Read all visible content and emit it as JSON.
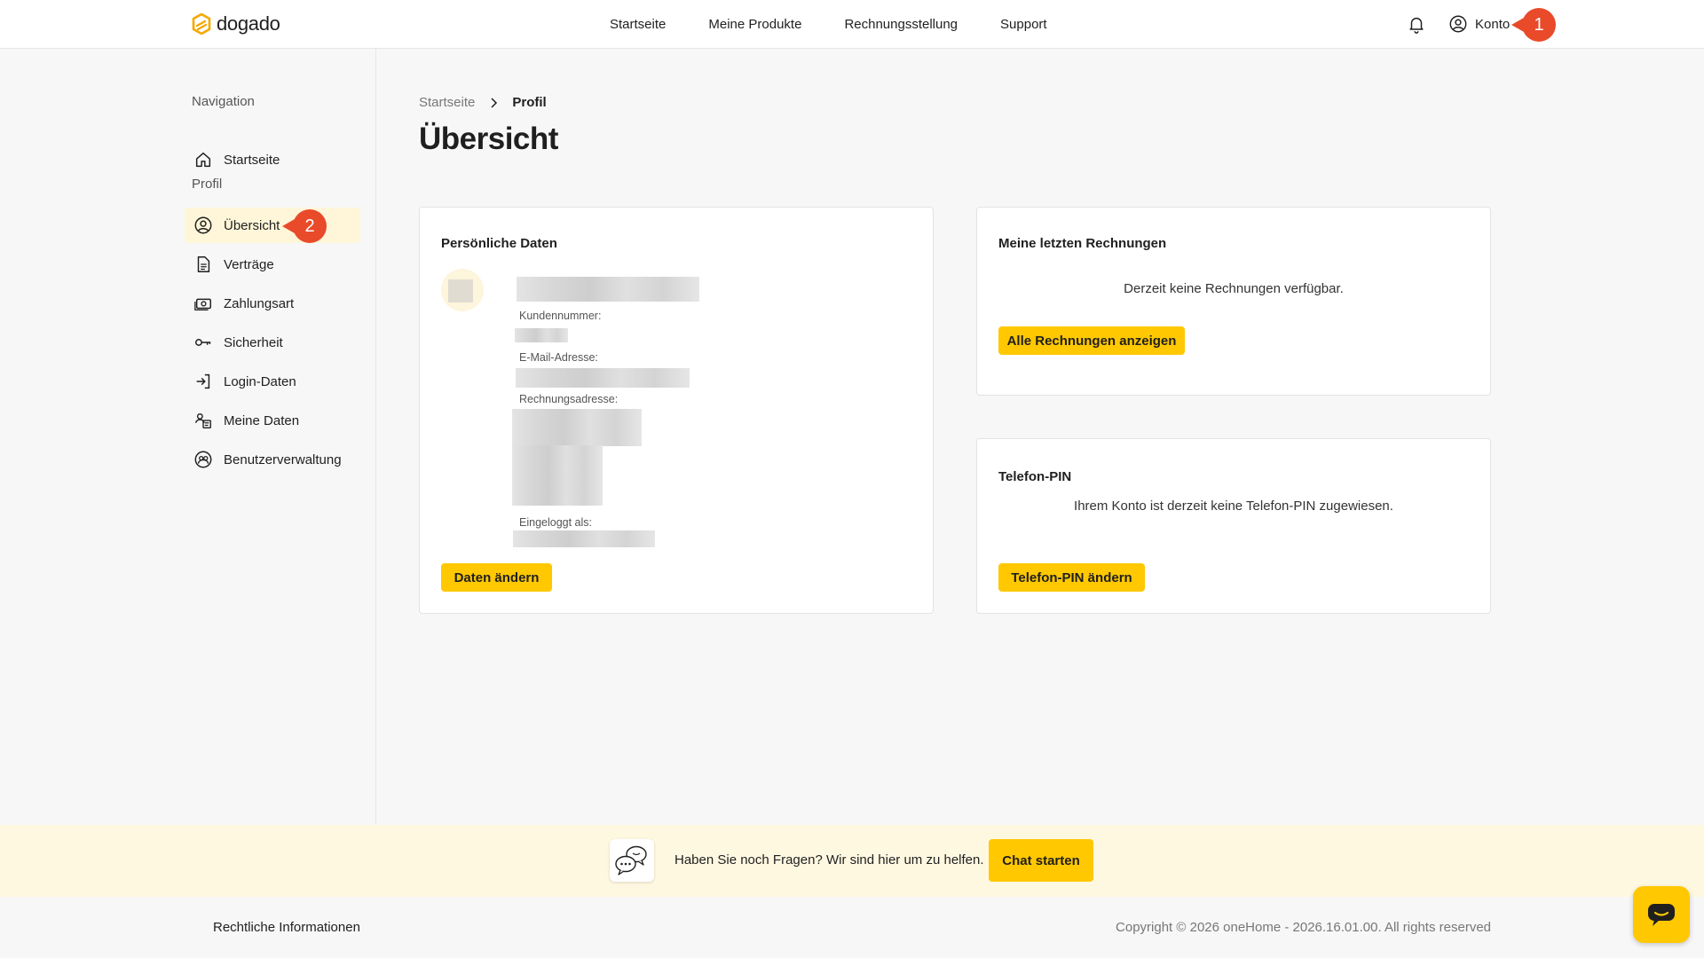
{
  "brand": {
    "name": "dogado",
    "accent": "#ffc800",
    "logo_color": "#f5a800"
  },
  "topnav": {
    "items": [
      {
        "label": "Startseite"
      },
      {
        "label": "Meine Produkte"
      },
      {
        "label": "Rechnungsstellung"
      },
      {
        "label": "Support"
      }
    ],
    "account_label": "Konto",
    "account_marker": "1"
  },
  "sidebar": {
    "section_navigation": "Navigation",
    "section_profile": "Profil",
    "items": [
      {
        "label": "Startseite",
        "icon": "home-icon"
      },
      {
        "label": "Übersicht",
        "icon": "user-circle-icon",
        "active": true
      },
      {
        "label": "Verträge",
        "icon": "document-icon"
      },
      {
        "label": "Zahlungsart",
        "icon": "money-icon"
      },
      {
        "label": "Sicherheit",
        "icon": "key-icon"
      },
      {
        "label": "Login-Daten",
        "icon": "login-icon"
      },
      {
        "label": "Meine Daten",
        "icon": "data-settings-icon"
      },
      {
        "label": "Benutzerverwaltung",
        "icon": "users-icon"
      }
    ],
    "active_marker": "2"
  },
  "breadcrumb": {
    "parent": "Startseite",
    "current": "Profil"
  },
  "page_title": "Übersicht",
  "personal_card": {
    "title": "Persönliche Daten",
    "customer_number_label": "Kundennummer:",
    "email_label": "E-Mail-Adresse:",
    "billing_address_label": "Rechnungsadresse:",
    "logged_in_as_label": "Eingeloggt als:",
    "edit_button": "Daten ändern"
  },
  "invoices_card": {
    "title": "Meine letzten Rechnungen",
    "empty_text": "Derzeit keine Rechnungen verfügbar.",
    "show_all_button": "Alle Rechnungen anzeigen"
  },
  "phone_pin_card": {
    "title": "Telefon-PIN",
    "text": "Ihrem Konto ist derzeit keine Telefon-PIN zugewiesen.",
    "change_button": "Telefon-PIN ändern"
  },
  "chat_banner": {
    "text": "Haben Sie noch Fragen? Wir sind hier um zu helfen.",
    "button": "Chat starten"
  },
  "footer": {
    "legal_link": "Rechtliche Informationen",
    "copyright": "Copyright © 2026 oneHome - 2026.16.01.00. All rights reserved"
  }
}
